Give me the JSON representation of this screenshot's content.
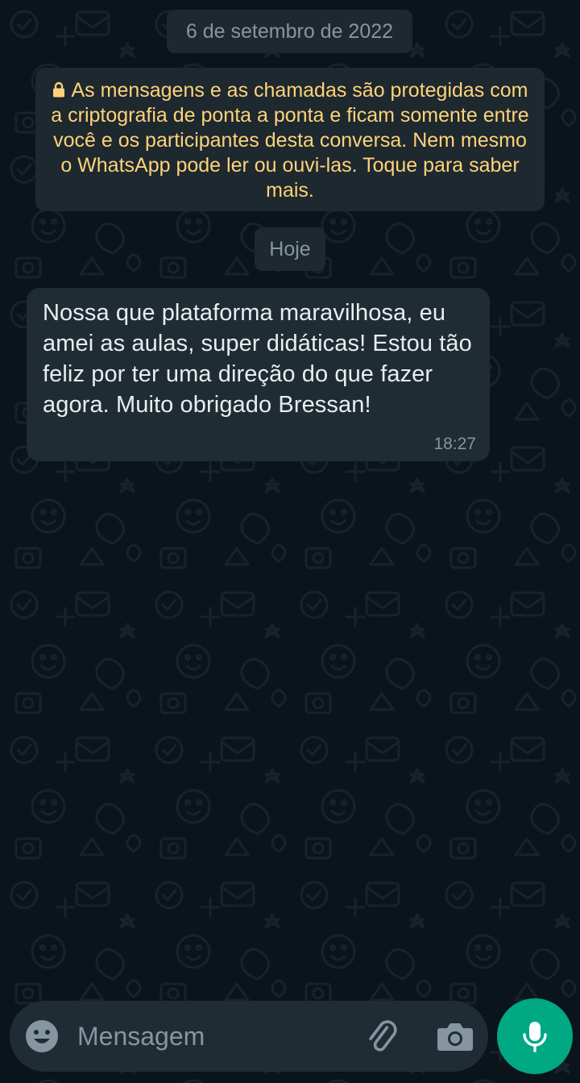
{
  "colors": {
    "background": "#0b141a",
    "chip": "#1d282f",
    "bubble": "#1f2c34",
    "notice_text": "#ffd279",
    "muted_text": "#8696a0",
    "message_text": "#e9edef",
    "accent": "#00a884"
  },
  "chat": {
    "date_separator": "6 de setembro de 2022",
    "encryption_notice": "As mensagens e as chamadas são protegidas com a criptografia de ponta a ponta e ficam somente entre você e os participantes desta conversa. Nem mesmo o WhatsApp pode ler ou ouvi-las. Toque para saber mais.",
    "today_separator": "Hoje",
    "messages": [
      {
        "text": "Nossa que plataforma maravilhosa, eu amei as aulas, super didáticas! Estou tão feliz por ter uma direção do que fazer agora. Muito obrigado Bressan!",
        "time": "18:27"
      }
    ]
  },
  "composer": {
    "placeholder": "Mensagem",
    "icons": {
      "emoji": "emoji-icon",
      "attach": "paperclip-icon",
      "camera": "camera-icon",
      "mic": "microphone-icon",
      "lock": "lock-icon"
    }
  }
}
